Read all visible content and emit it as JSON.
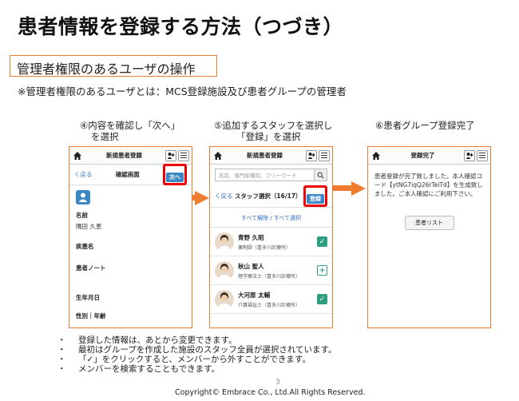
{
  "slide": {
    "title": "患者情報を登録する方法（つづき）",
    "section": "管理者権限のあるユーザの操作",
    "note": "※管理者権限のあるユーザとは：MCS登録施設及び患者グループの管理者",
    "page_number": "3",
    "copyright": "Copyright© Embrace Co., Ltd.All Rights Reserved."
  },
  "steps": [
    {
      "label_line1": "④内容を確認し「次へ」",
      "label_line2": "を選択"
    },
    {
      "label_line1": "⑤追加するスタッフを選択し",
      "label_line2": "「登録」を選択"
    },
    {
      "label_line1": "⑥患者グループ登録完了",
      "label_line2": ""
    }
  ],
  "screen1": {
    "header_title": "新規患者登録",
    "back_label": "く戻る",
    "sub_title": "確認画面",
    "next_button": "次へ",
    "fields": [
      {
        "label": "名前",
        "value": "隅田 久恵"
      },
      {
        "label": "疾患名",
        "value": ""
      },
      {
        "label": "患者ノート",
        "value": ""
      },
      {
        "label": "生年月日",
        "value": ""
      },
      {
        "label": "性別｜年齢",
        "value": ""
      }
    ]
  },
  "screen2": {
    "header_title": "新規患者登録",
    "search_placeholder": "名前、専門家種別、フリーワード",
    "back_label": "く戻る",
    "sub_title": "スタッフ選択（16/17）",
    "register_button": "登録",
    "select_links": "すべて解除 / すべて選択",
    "staff": [
      {
        "name": "青野 久昭",
        "role": "薬剤師（喜多川診療所）",
        "checked": true
      },
      {
        "name": "秋山 聖人",
        "role": "理学療法士（喜多川診療所）",
        "checked": false
      },
      {
        "name": "大河原 太輔",
        "role": "介護福祉士（喜多川診療所）",
        "checked": true
      }
    ],
    "check_on_glyph": "✓",
    "check_off_glyph": "+"
  },
  "screen3": {
    "header_title": "登録完了",
    "message": "患者登録が完了致しました。本人確認コード【ytNG7iqQ26rTeiTd】を生成致しました。ご本人確認にご利用下さい。",
    "list_button": "患者リスト"
  },
  "header_icons": {
    "add_user": "👤+",
    "menu": "≡"
  },
  "bullets": [
    "登録した情報は、あとから変更できます。",
    "最初はグループを作成した施設のスタッフ全員が選択されています。",
    "「✓」をクリックすると、メンバーから外すことができます。",
    "メンバーを検索することもできます。"
  ],
  "colors": {
    "accent": "#ee7d2f",
    "link": "#2f6fc8",
    "button": "#3b88c6",
    "highlight": "#e00000",
    "check": "#2f9e80"
  }
}
